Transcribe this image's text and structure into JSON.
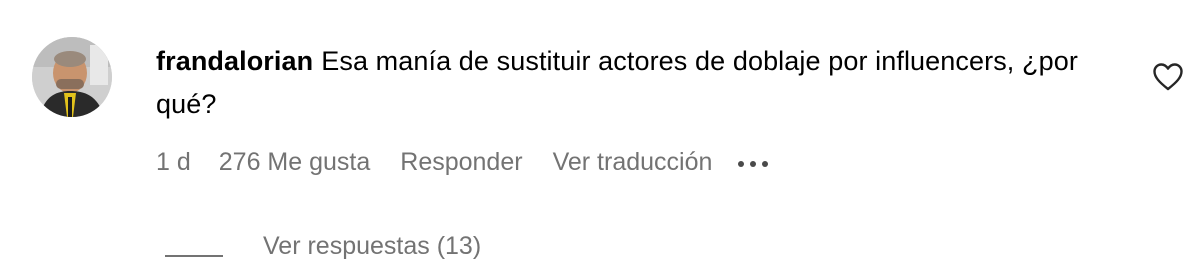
{
  "comment": {
    "username": "frandalorian",
    "text": "Esa manía de sustituir actores de doblaje por influencers, ¿por qué?",
    "time": "1 d",
    "likes": "276 Me gusta",
    "reply_label": "Responder",
    "translate_label": "Ver traducción",
    "more_icon": "more-options-icon",
    "like_icon": "heart-icon",
    "avatar": "user-avatar"
  },
  "replies": {
    "label": "Ver respuestas (13)"
  },
  "colors": {
    "text": "#000000",
    "secondary": "#737373",
    "background": "#ffffff"
  }
}
